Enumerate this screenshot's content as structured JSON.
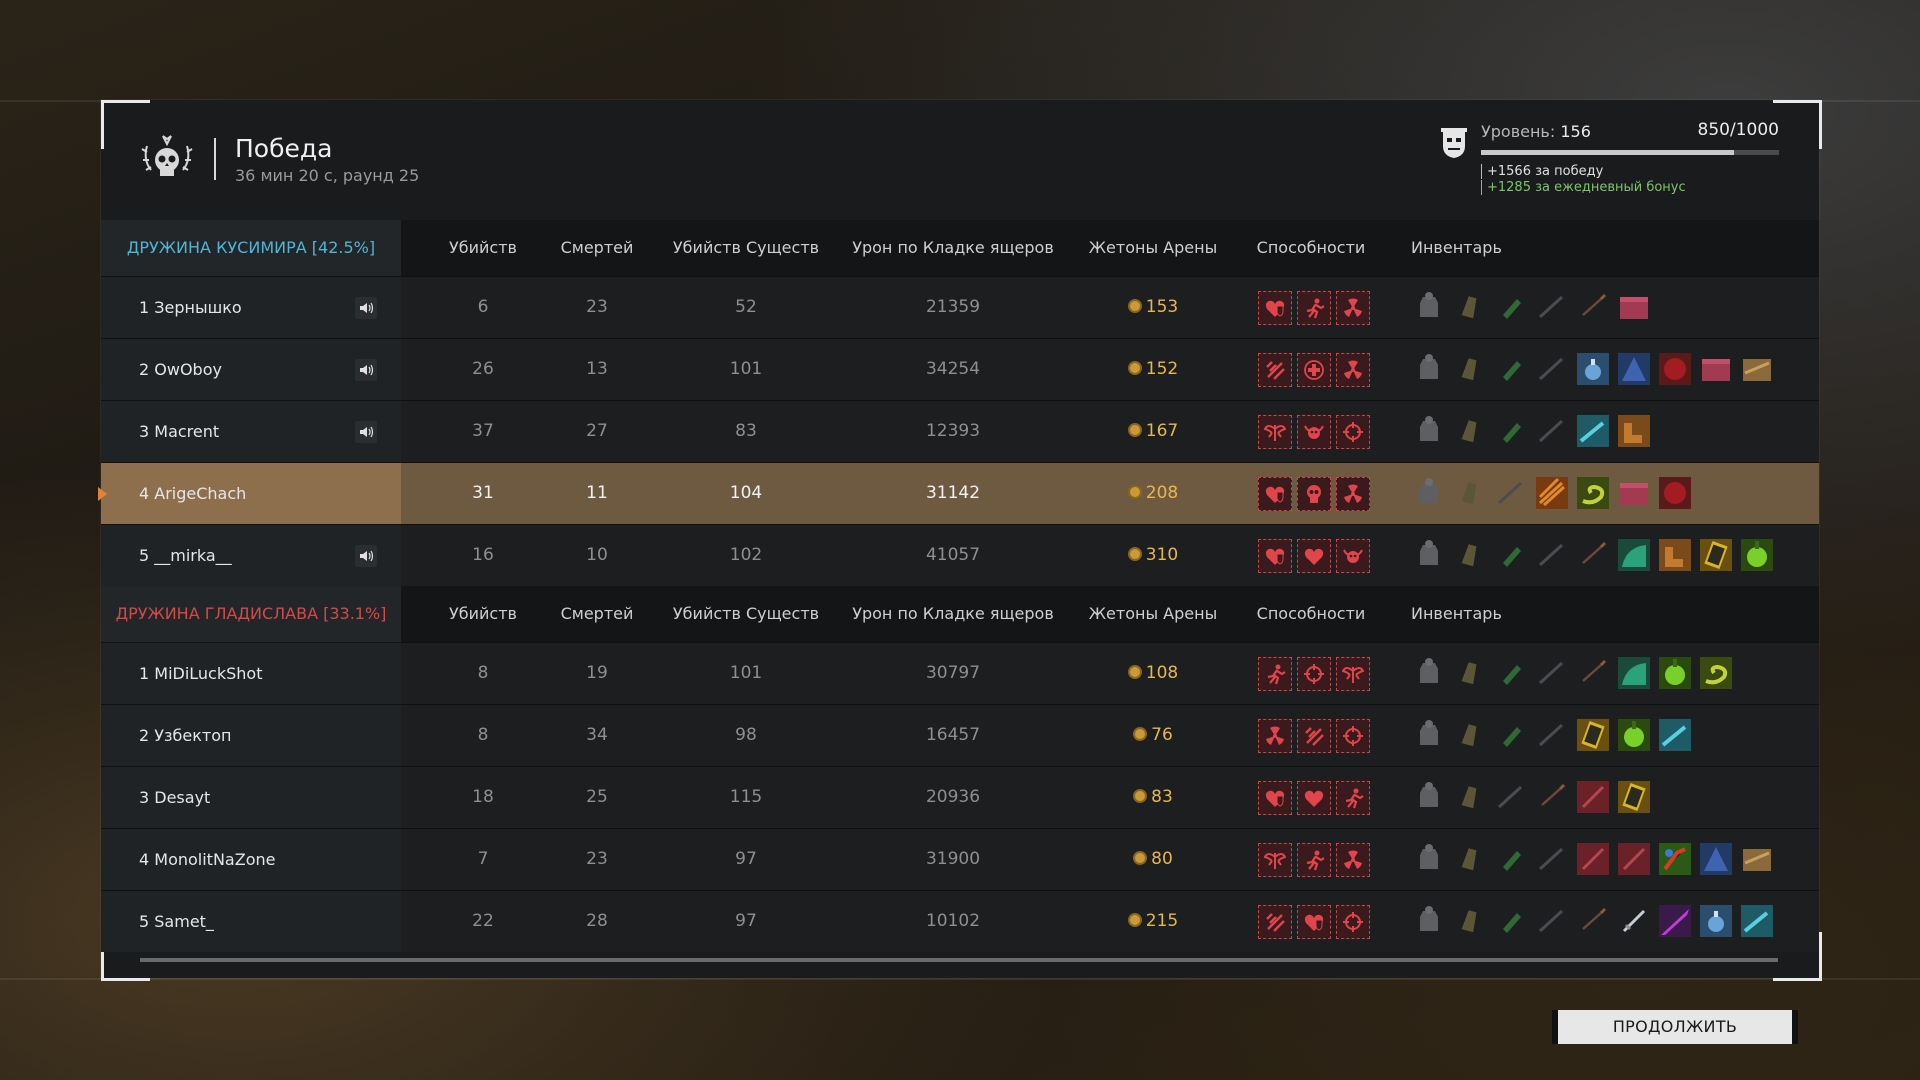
{
  "header": {
    "title": "Победа",
    "subtitle": "36 мин 20 с, раунд 25"
  },
  "level": {
    "label": "Уровень:",
    "value": "156",
    "xp_text": "850/1000",
    "xp_fraction": 0.85,
    "bonus_win": "+1566 за победу",
    "bonus_daily": "+1285 за ежедневный бонус"
  },
  "columns": [
    "Убийств",
    "Смертей",
    "Убийств Существ",
    "Урон по Кладке ящеров",
    "Жетоны Арены",
    "Способности",
    "Инвентарь"
  ],
  "teams": [
    {
      "name": "ДРУЖИНА КУСИМИРА [42.5%]",
      "players": [
        {
          "rank_name": "1 Зернышко",
          "speaker": true,
          "kills": "6",
          "deaths": "23",
          "creature_kills": "52",
          "damage": "21359",
          "tokens": "153",
          "abilities": [
            "heart-shield-icon",
            "runner-icon",
            "radiation-icon"
          ],
          "inventory": [
            "armor-icon",
            "flask-icon",
            "grenade-icon",
            "rifle-icon",
            "spear-icon",
            "crate-icon"
          ]
        },
        {
          "rank_name": "2 OwOboy",
          "speaker": true,
          "kills": "26",
          "deaths": "13",
          "creature_kills": "101",
          "damage": "34254",
          "tokens": "152",
          "abilities": [
            "speed-icon",
            "medic-cross-icon",
            "radiation-icon"
          ],
          "inventory": [
            "armor-icon",
            "flask-icon",
            "grenade-icon",
            "rifle-icon",
            "bomb-icon",
            "tent-icon",
            "orb-icon",
            "crate-icon",
            "chest-icon"
          ]
        },
        {
          "rank_name": "3 Macrent",
          "speaker": true,
          "kills": "37",
          "deaths": "27",
          "creature_kills": "83",
          "damage": "12393",
          "tokens": "167",
          "abilities": [
            "wings-icon",
            "bull-skull-icon",
            "crosshair-icon"
          ],
          "inventory": [
            "armor-icon",
            "flask-icon",
            "grenade-icon",
            "rifle-icon",
            "fish-icon",
            "boots-icon"
          ]
        },
        {
          "rank_name": "4 ArigeChach",
          "speaker": false,
          "highlight": true,
          "kills": "31",
          "deaths": "11",
          "creature_kills": "104",
          "damage": "31142",
          "tokens": "208",
          "abilities": [
            "heart-shield-icon",
            "skull-icon",
            "radiation-icon"
          ],
          "inventory": [
            "armor-icon",
            "flask-icon",
            "rifle-icon",
            "claw-icon",
            "snake-icon",
            "crate-icon",
            "orb-icon"
          ]
        },
        {
          "rank_name": "5 __mirka__",
          "speaker": true,
          "kills": "16",
          "deaths": "10",
          "creature_kills": "102",
          "damage": "41057",
          "tokens": "310",
          "abilities": [
            "heart-shield-icon",
            "heart-icon",
            "bull-skull-icon"
          ],
          "inventory": [
            "armor-icon",
            "flask-icon",
            "grenade-icon",
            "rifle-icon",
            "spear-icon",
            "cloak-icon",
            "boots-icon",
            "book-icon",
            "lime-orb-icon"
          ]
        }
      ]
    },
    {
      "name": "ДРУЖИНА ГЛАДИСЛАВА [33.1%]",
      "players": [
        {
          "rank_name": "1 MiDiLuckShot",
          "speaker": false,
          "kills": "8",
          "deaths": "19",
          "creature_kills": "101",
          "damage": "30797",
          "tokens": "108",
          "abilities": [
            "runner-icon",
            "crosshair-icon",
            "wings-icon"
          ],
          "inventory": [
            "armor-icon",
            "flask-icon",
            "grenade-icon",
            "rifle-icon",
            "spear-icon",
            "cloak-icon",
            "lime-orb-icon",
            "snake-icon"
          ]
        },
        {
          "rank_name": "2 Узбектоп",
          "speaker": false,
          "kills": "8",
          "deaths": "34",
          "creature_kills": "98",
          "damage": "16457",
          "tokens": "76",
          "abilities": [
            "radiation-icon",
            "speed-icon",
            "crosshair-icon"
          ],
          "inventory": [
            "armor-icon",
            "flask-icon",
            "grenade-icon",
            "rifle-icon",
            "book-icon",
            "lime-orb-icon",
            "fish-icon"
          ]
        },
        {
          "rank_name": "3 Desayt",
          "speaker": false,
          "kills": "18",
          "deaths": "25",
          "creature_kills": "115",
          "damage": "20936",
          "tokens": "83",
          "abilities": [
            "heart-shield-icon",
            "heart-icon",
            "runner-icon"
          ],
          "inventory": [
            "armor-icon",
            "flask-icon",
            "rifle-icon",
            "spear-icon",
            "dagger-card-icon",
            "book-icon"
          ]
        },
        {
          "rank_name": "4 MonolitNaZone",
          "speaker": false,
          "kills": "7",
          "deaths": "23",
          "creature_kills": "97",
          "damage": "31900",
          "tokens": "80",
          "abilities": [
            "wings-icon",
            "runner-icon",
            "radiation-icon"
          ],
          "inventory": [
            "armor-icon",
            "flask-icon",
            "grenade-icon",
            "rifle-icon",
            "dagger-card-icon",
            "dagger-card-icon",
            "parrot-icon",
            "tent-icon",
            "chest-icon"
          ]
        },
        {
          "rank_name": "5 Samet_",
          "speaker": false,
          "kills": "22",
          "deaths": "28",
          "creature_kills": "97",
          "damage": "10102",
          "tokens": "215",
          "abilities": [
            "speed-icon",
            "heart-shield-icon",
            "crosshair-icon"
          ],
          "inventory": [
            "armor-icon",
            "flask-icon",
            "grenade-icon",
            "rifle-icon",
            "spear-icon",
            "sword-icon",
            "purple-blade-icon",
            "bomb-icon",
            "fish-icon"
          ]
        }
      ]
    }
  ],
  "continue_label": "ПРОДОЛЖИТЬ",
  "colors": {
    "team_a": "#4fb6d6",
    "team_b": "#d34a47",
    "highlight_row": "#6e5a40",
    "ability_red": "#e0454c",
    "token_gold": "#e6b84c"
  }
}
